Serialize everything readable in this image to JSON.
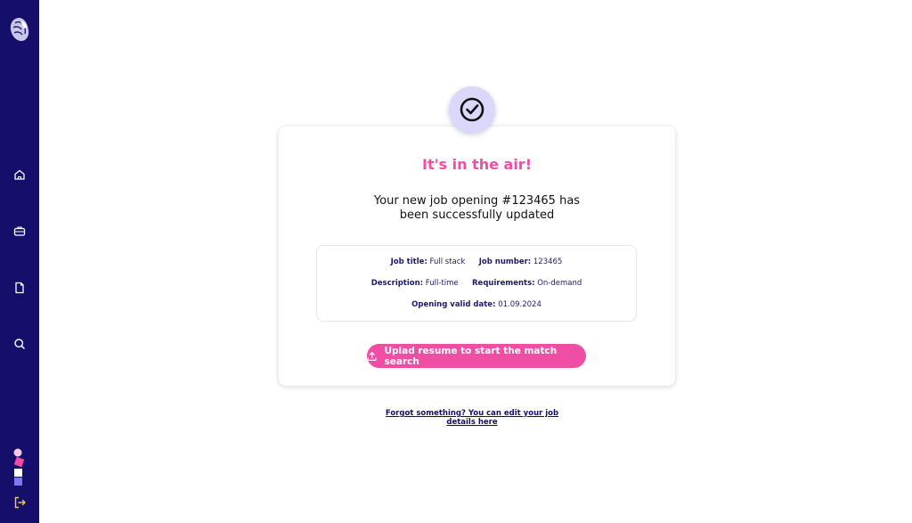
{
  "sidebar": {
    "nav": [
      {
        "icon": "home-icon"
      },
      {
        "icon": "briefcase-icon"
      },
      {
        "icon": "document-icon"
      },
      {
        "icon": "search-icon"
      }
    ],
    "logout_icon": "logout-icon",
    "colors": {
      "background": "#140f6b",
      "accent": "#f2c84b"
    }
  },
  "confirmation": {
    "icon": "check-circle-icon",
    "headline": "It's in the air!",
    "message": "Your new job opening #123465 has been successfully updated",
    "details": {
      "job_title_label": "Job title:",
      "job_title_value": "Full stack",
      "job_number_label": "Job number:",
      "job_number_value": "123465",
      "description_label": "Description:",
      "description_value": "Full-time",
      "requirements_label": "Requirements:",
      "requirements_value": "On-demand",
      "valid_date_label": "Opening valid date:",
      "valid_date_value": "01.09.2024"
    },
    "upload_button_label": "Uplad resume to start the match search",
    "upload_icon": "upload-icon",
    "edit_link": "Forgot something? You can edit your job details here"
  },
  "colors": {
    "accent": "#ee4fa5",
    "brand": "#140f6b",
    "check_bg": "#d9d8fb"
  }
}
